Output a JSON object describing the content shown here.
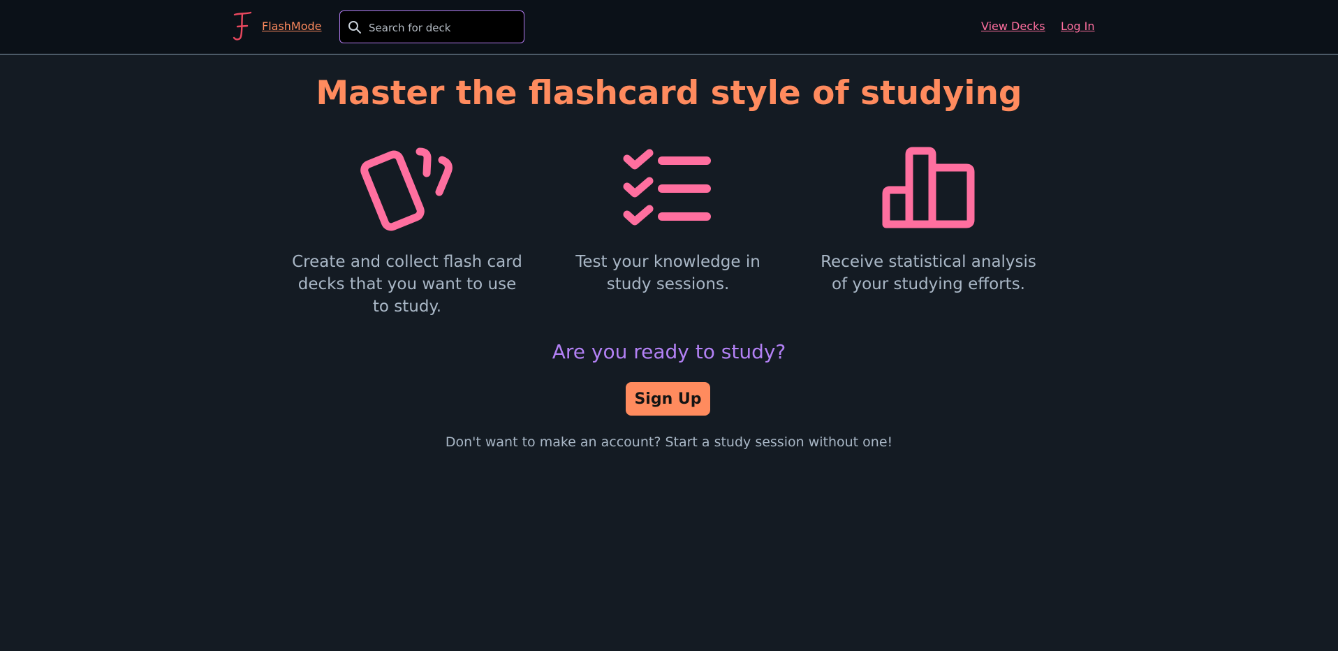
{
  "colors": {
    "background": "#141b23",
    "navbar": "#0b1118",
    "accent_orange": "#ff8b5e",
    "accent_pink": "#ff6f9f",
    "accent_purple": "#b381f5",
    "text_muted": "#a9b7c6"
  },
  "navbar": {
    "logo_icon": "letter-f-logo-icon",
    "brand_label": "FlashMode",
    "search": {
      "icon": "search-icon",
      "placeholder": "Search for deck",
      "value": ""
    },
    "links": {
      "view_decks": "View Decks",
      "log_in": "Log In"
    }
  },
  "hero": {
    "headline": "Master the flashcard style of studying"
  },
  "features": [
    {
      "icon": "cards-icon",
      "text": "Create and collect flash card decks that you want to use to study."
    },
    {
      "icon": "checklist-icon",
      "text": "Test your knowledge in study sessions."
    },
    {
      "icon": "bar-chart-icon",
      "text": "Receive statistical analysis of your studying efforts."
    }
  ],
  "cta": {
    "question": "Are you ready to study?",
    "signup_label": "Sign Up",
    "guest_text": "Don't want to make an account? Start a study session without one!"
  }
}
